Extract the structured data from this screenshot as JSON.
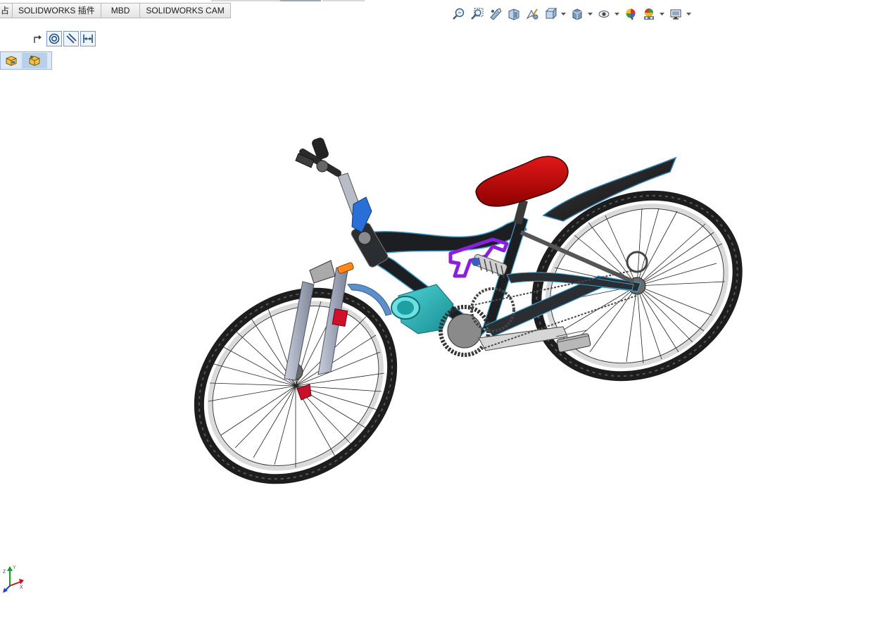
{
  "window": {
    "title": ""
  },
  "command_tabs": [
    {
      "label": "占"
    },
    {
      "label": "SOLIDWORKS 插件"
    },
    {
      "label": "MBD"
    },
    {
      "label": "SOLIDWORKS CAM"
    }
  ],
  "heads_up_toolbar": {
    "items": [
      {
        "icon": "zoom-to-fit-icon"
      },
      {
        "icon": "zoom-to-area-icon"
      },
      {
        "icon": "previous-view-icon"
      },
      {
        "icon": "section-view-icon"
      },
      {
        "icon": "dynamic-annotation-icon"
      },
      {
        "icon": "view-orientation-icon",
        "dropdown": true
      },
      {
        "icon": "display-style-icon",
        "dropdown": true
      },
      {
        "icon": "hide-show-items-icon",
        "dropdown": true
      },
      {
        "icon": "edit-appearance-icon"
      },
      {
        "icon": "apply-scene-icon",
        "dropdown": true
      },
      {
        "icon": "view-settings-icon",
        "dropdown": true
      }
    ]
  },
  "selection_toolbar": {
    "items": [
      {
        "icon": "select-arrow-icon"
      },
      {
        "icon": "concentric-mate-icon"
      },
      {
        "icon": "parallel-mate-icon"
      },
      {
        "icon": "distance-mate-icon"
      }
    ]
  },
  "part_toolbar": {
    "items": [
      {
        "icon": "part-icon"
      },
      {
        "icon": "part-selected-icon"
      }
    ]
  },
  "model": {
    "name": "bicycle-assembly"
  },
  "triad": {
    "axes": [
      "X",
      "Y",
      "Z"
    ]
  },
  "colors": {
    "saddle": "#c40000",
    "frame": "#1c1e21",
    "frame_highlight": "#3aa0d0",
    "suspension_bracket": "#8a1fe0",
    "bottle_cage": "#2bb5b8",
    "fork_stanchion": "#9aa3b8",
    "fork_band": "#d0102a",
    "brake_lever": "#2a6ed8",
    "orange_clamp": "#ff8a1a",
    "tire": "#2a2a2a",
    "rim": "#e6e6e6"
  }
}
